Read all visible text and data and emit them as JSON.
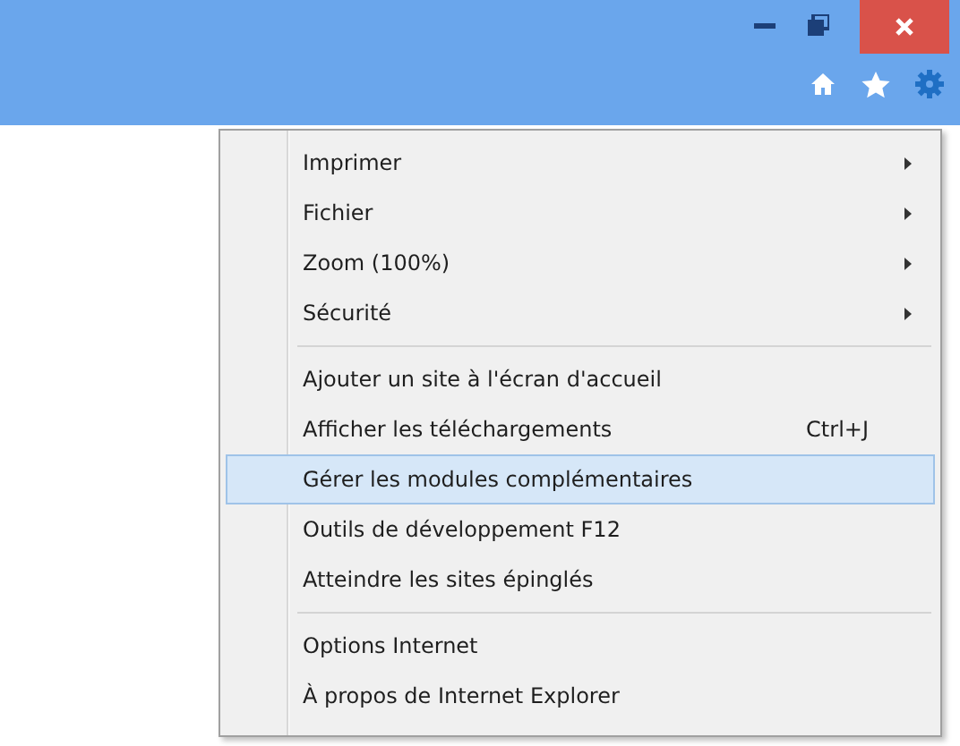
{
  "menu": {
    "groups": [
      {
        "items": [
          {
            "label": "Imprimer",
            "submenu": true,
            "selected": false
          },
          {
            "label": "Fichier",
            "submenu": true,
            "selected": false
          },
          {
            "label": "Zoom (100%)",
            "submenu": true,
            "selected": false
          },
          {
            "label": "Sécurité",
            "submenu": true,
            "selected": false
          }
        ]
      },
      {
        "items": [
          {
            "label": "Ajouter un site à l'écran d'accueil",
            "submenu": false,
            "selected": false
          },
          {
            "label": "Afficher les téléchargements",
            "shortcut": "Ctrl+J",
            "submenu": false,
            "selected": false
          },
          {
            "label": "Gérer les modules complémentaires",
            "submenu": false,
            "selected": true
          },
          {
            "label": "Outils de développement F12",
            "submenu": false,
            "selected": false
          },
          {
            "label": "Atteindre les sites épinglés",
            "submenu": false,
            "selected": false
          }
        ]
      },
      {
        "items": [
          {
            "label": "Options Internet",
            "submenu": false,
            "selected": false
          },
          {
            "label": "À propos de Internet Explorer",
            "submenu": false,
            "selected": false
          }
        ]
      }
    ]
  }
}
